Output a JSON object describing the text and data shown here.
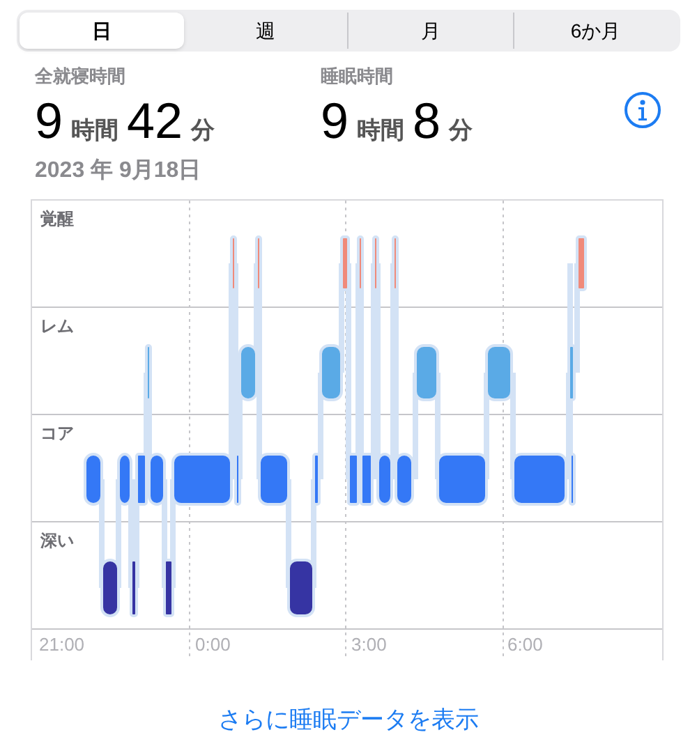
{
  "tabs": [
    {
      "label": "日",
      "selected": true
    },
    {
      "label": "週",
      "selected": false
    },
    {
      "label": "月",
      "selected": false
    },
    {
      "label": "6か月",
      "selected": false
    }
  ],
  "stats": [
    {
      "label": "全就寝時間",
      "parts": [
        {
          "kind": "number",
          "text": "9"
        },
        {
          "kind": "unit",
          "text": "時間"
        },
        {
          "kind": "number",
          "text": "42"
        },
        {
          "kind": "unit",
          "text": "分"
        }
      ]
    },
    {
      "label": "睡眠時間",
      "parts": [
        {
          "kind": "number",
          "text": "9"
        },
        {
          "kind": "unit",
          "text": "時間"
        },
        {
          "kind": "number",
          "text": "8"
        },
        {
          "kind": "unit",
          "text": "分"
        }
      ]
    }
  ],
  "date": "2023 年 9月18日",
  "chart": {
    "stages": [
      "覚醒",
      "レム",
      "コア",
      "深い"
    ],
    "times": [
      "21:00",
      "0:00",
      "3:00",
      "6:00"
    ]
  },
  "link": "さらに睡眠データを表示"
}
